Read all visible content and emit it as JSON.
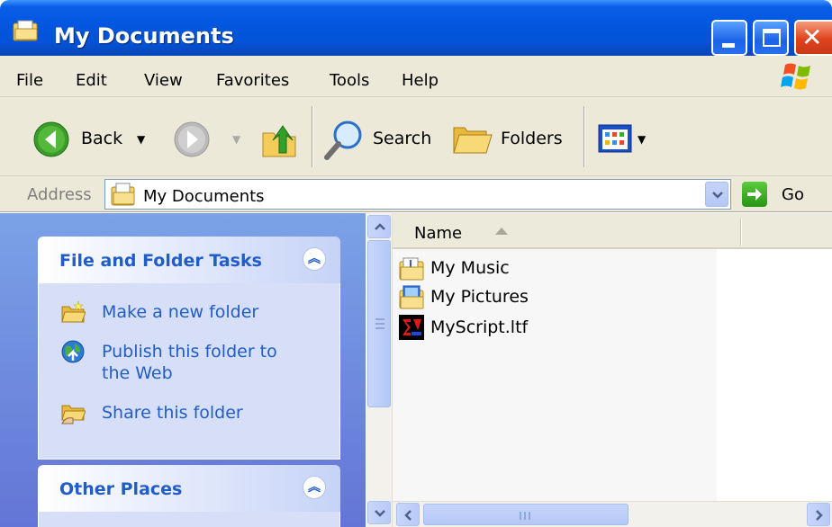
{
  "window": {
    "title": "My Documents",
    "buttons": [
      "minimize",
      "maximize",
      "close"
    ]
  },
  "menubar": {
    "items": [
      "File",
      "Edit",
      "View",
      "Favorites",
      "Tools",
      "Help"
    ]
  },
  "toolbar": {
    "back_label": "Back",
    "search_label": "Search",
    "folders_label": "Folders"
  },
  "address": {
    "label": "Address",
    "value": "My Documents",
    "go_label": "Go"
  },
  "taskpane": {
    "file_tasks": {
      "title": "File and Folder Tasks",
      "links": [
        {
          "label_line1": "Make a new folder",
          "label_line2": "",
          "icon": "new-folder-icon"
        },
        {
          "label_line1": "Publish this folder to",
          "label_line2": "the Web",
          "icon": "publish-web-icon"
        },
        {
          "label_line1": "Share this folder",
          "label_line2": "",
          "icon": "share-folder-icon"
        }
      ]
    },
    "other_places": {
      "title": "Other Places"
    }
  },
  "filelist": {
    "column_name": "Name",
    "files": [
      {
        "name": "My Music",
        "icon": "music-folder-icon"
      },
      {
        "name": "My Pictures",
        "icon": "pictures-folder-icon"
      },
      {
        "name": "MyScript.ltf",
        "icon": "script-file-icon"
      }
    ]
  },
  "colors": {
    "titlebar": "#0453d8",
    "taskpane_bg": "#7ba2e7",
    "link": "#215dc6",
    "chrome": "#ece9d8"
  }
}
